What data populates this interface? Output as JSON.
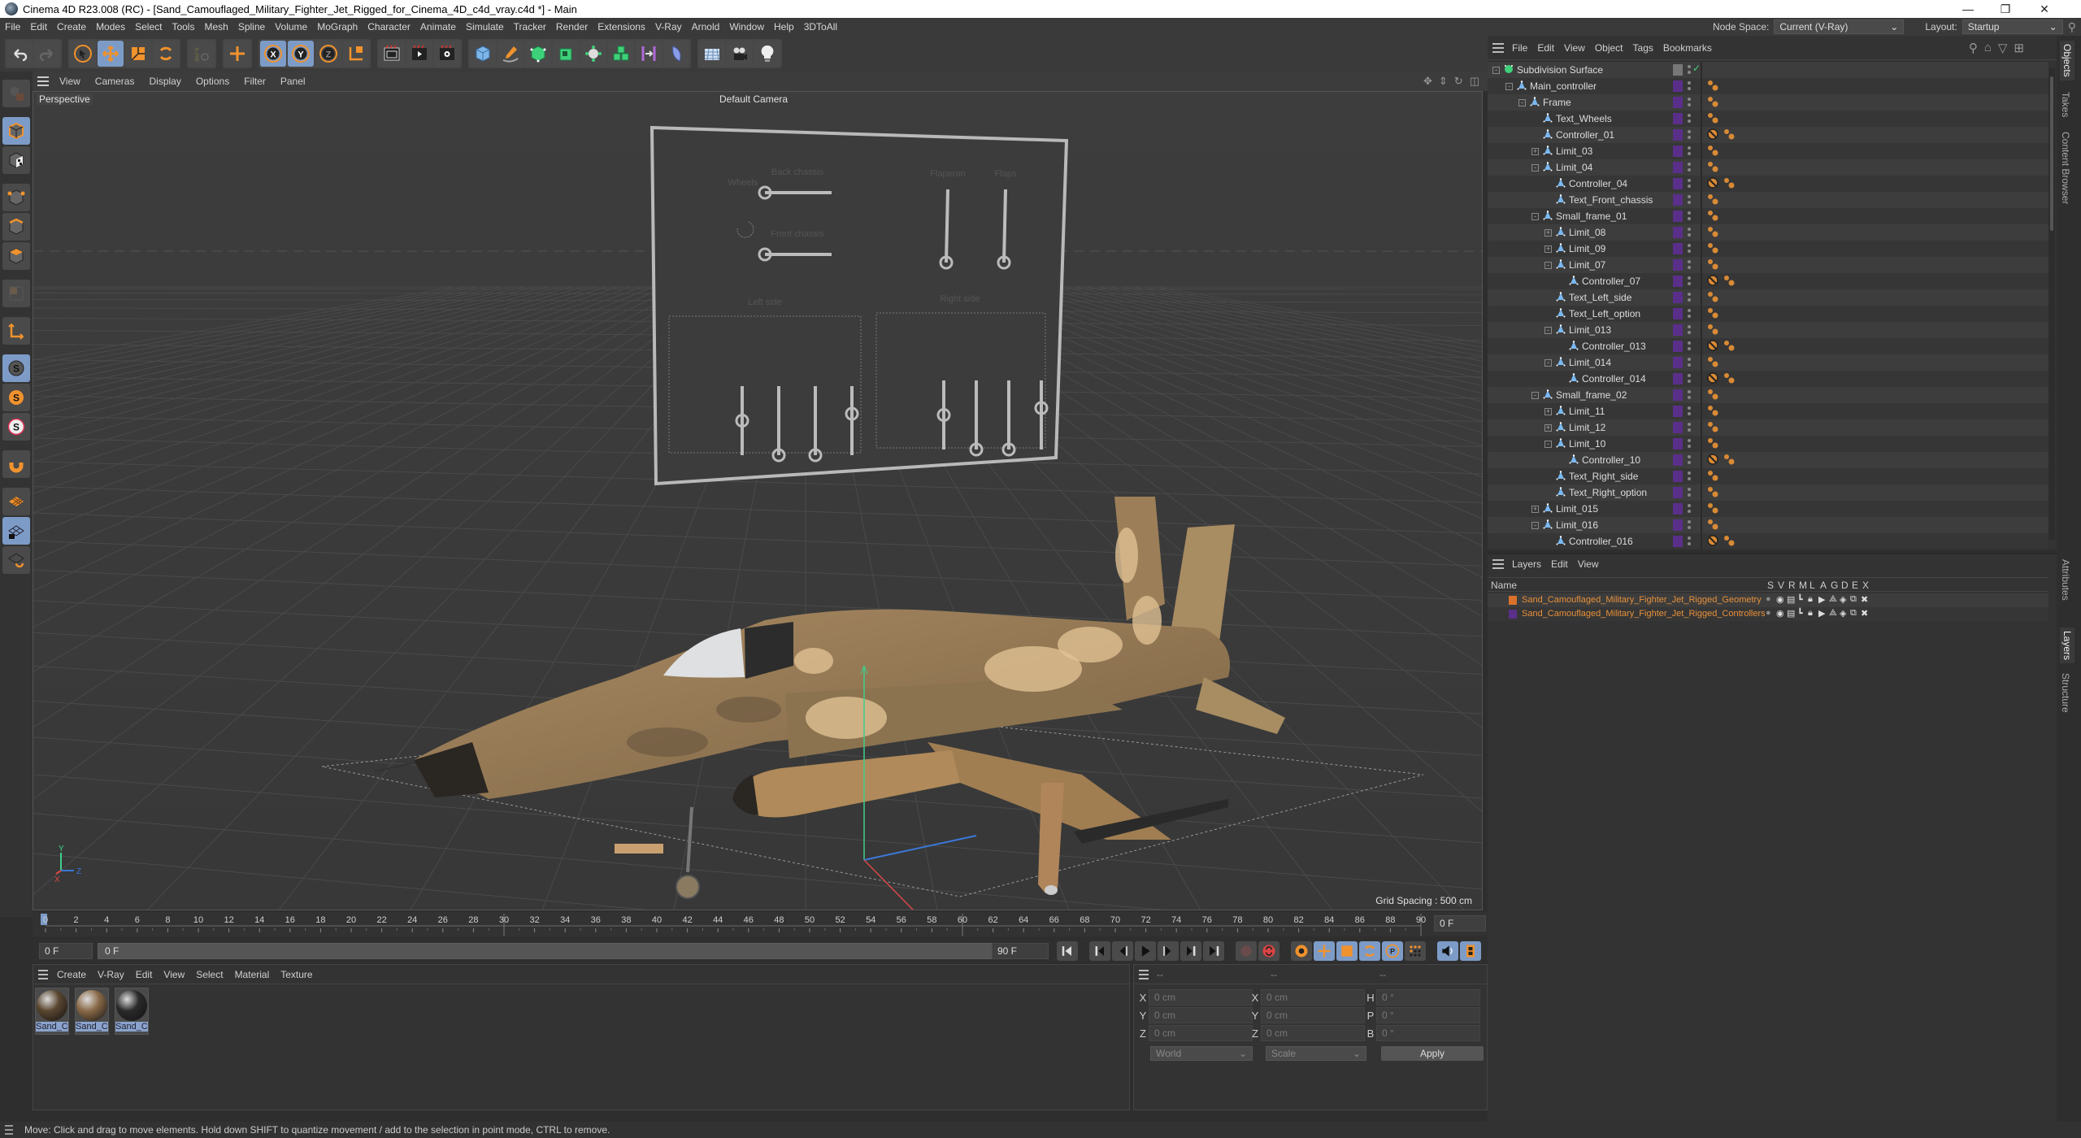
{
  "window": {
    "title": "Cinema 4D R23.008 (RC) - [Sand_Camouflaged_Military_Fighter_Jet_Rigged_for_Cinema_4D_c4d_vray.c4d *] - Main",
    "controls": {
      "minimize": "—",
      "maximize": "❐",
      "close": "✕"
    }
  },
  "menubar": {
    "items": [
      "File",
      "Edit",
      "Create",
      "Modes",
      "Select",
      "Tools",
      "Mesh",
      "Spline",
      "Volume",
      "MoGraph",
      "Character",
      "Animate",
      "Simulate",
      "Tracker",
      "Render",
      "Extensions",
      "V-Ray",
      "Arnold",
      "Window",
      "Help",
      "3DToAll"
    ],
    "node_space_label": "Node Space:",
    "node_space_value": "Current (V-Ray)",
    "layout_label": "Layout:",
    "layout_value": "Startup"
  },
  "toolbar": {
    "tools": [
      "undo",
      "redo",
      "select",
      "move",
      "scale",
      "rotate",
      "psr",
      "transform",
      "x-axis",
      "y-axis",
      "z-axis",
      "coord-system",
      "render-region",
      "render-view",
      "render-settings",
      "cube",
      "pen",
      "subdivision",
      "extrude",
      "array",
      "cloner",
      "symmetry",
      "deformer",
      "floor",
      "camera",
      "light"
    ],
    "active": [
      "move",
      "x-axis",
      "y-axis"
    ]
  },
  "left_toolbar": {
    "tools": [
      "make-editable",
      "model-mode",
      "texture-mode",
      "point-mode",
      "edge-mode",
      "polygon-mode",
      "uv-mode",
      "axis-mode",
      "snap",
      "snap-settings",
      "snap-3d",
      "magnet",
      "workplane",
      "workplane-lock",
      "workplane-align"
    ]
  },
  "viewport": {
    "menu": [
      "View",
      "Cameras",
      "Display",
      "Options",
      "Filter",
      "Panel"
    ],
    "projection": "Perspective",
    "camera": "Default Camera",
    "grid_spacing": "Grid Spacing : 500 cm",
    "axis_labels": {
      "x": "X",
      "y": "Y",
      "z": "Z"
    },
    "controls_board": {
      "top_sliders": [
        {
          "label": "Back chassis",
          "orientation": "horizontal",
          "value": 0
        },
        {
          "label": "Front chassis",
          "orientation": "horizontal",
          "value": 0
        },
        {
          "label": "Flaperon",
          "orientation": "vertical",
          "value": 0
        },
        {
          "label": "Flaps",
          "orientation": "vertical",
          "value": 0
        }
      ],
      "wheels_label": "Wheels",
      "left_group": {
        "label": "Left side",
        "sliders": [
          0.5,
          0,
          0,
          0.6
        ]
      },
      "right_group": {
        "label": "Right side",
        "sliders": [
          0.5,
          0,
          0,
          0.6
        ]
      }
    }
  },
  "timeline": {
    "ticks": [
      0,
      2,
      4,
      6,
      8,
      10,
      12,
      14,
      16,
      18,
      20,
      22,
      24,
      26,
      28,
      30,
      32,
      34,
      36,
      38,
      40,
      42,
      44,
      46,
      48,
      50,
      52,
      54,
      56,
      58,
      60,
      62,
      64,
      66,
      68,
      70,
      72,
      74,
      76,
      78,
      80,
      82,
      84,
      86,
      88,
      90
    ],
    "current_frame": "0 F",
    "start_field": "0 F",
    "range_start": "0 F",
    "range_end": "90 F",
    "end_field": "90 F",
    "current_frame_right": "0 F"
  },
  "material_manager": {
    "menu": [
      "Create",
      "V-Ray",
      "Edit",
      "View",
      "Select",
      "Material",
      "Texture"
    ],
    "materials": [
      {
        "name": "Sand_Ca",
        "color": "#5a4630"
      },
      {
        "name": "Sand_Ca",
        "color": "#8a6a48"
      },
      {
        "name": "Sand_Ca",
        "color": "#2a2a2a"
      }
    ]
  },
  "coordinates": {
    "header": [
      "--",
      "--",
      "--"
    ],
    "position": {
      "X": "0 cm",
      "Y": "0 cm",
      "Z": "0 cm"
    },
    "size": {
      "X": "0 cm",
      "Y": "0 cm",
      "Z": "0 cm"
    },
    "rotation": {
      "H": "0 °",
      "P": "0 °",
      "B": "0 °"
    },
    "mode": "World",
    "size_mode": "Scale",
    "apply": "Apply"
  },
  "status": "Move: Click and drag to move elements. Hold down SHIFT to quantize movement / add to the selection in point mode, CTRL to remove.",
  "object_manager": {
    "menu": [
      "File",
      "Edit",
      "View",
      "Object",
      "Tags",
      "Bookmarks"
    ],
    "objects": [
      {
        "name": "Subdivision Surface",
        "depth": 0,
        "exp": "-",
        "type": "subdiv",
        "tags": []
      },
      {
        "name": "Main_controller",
        "depth": 1,
        "exp": "-",
        "type": "null",
        "tags": [
          "xpresso"
        ]
      },
      {
        "name": "Frame",
        "depth": 2,
        "exp": "-",
        "type": "null",
        "tags": [
          "xpresso"
        ]
      },
      {
        "name": "Text_Wheels",
        "depth": 3,
        "exp": "",
        "type": "null",
        "tags": [
          "xpresso"
        ]
      },
      {
        "name": "Controller_01",
        "depth": 3,
        "exp": "",
        "type": "null",
        "tags": [
          "protect",
          "xpresso"
        ]
      },
      {
        "name": "Limit_03",
        "depth": 3,
        "exp": "+",
        "type": "null",
        "tags": [
          "xpresso"
        ]
      },
      {
        "name": "Limit_04",
        "depth": 3,
        "exp": "-",
        "type": "null",
        "tags": [
          "xpresso"
        ]
      },
      {
        "name": "Controller_04",
        "depth": 4,
        "exp": "",
        "type": "null",
        "tags": [
          "protect",
          "xpresso"
        ]
      },
      {
        "name": "Text_Front_chassis",
        "depth": 4,
        "exp": "",
        "type": "null",
        "tags": [
          "xpresso"
        ]
      },
      {
        "name": "Small_frame_01",
        "depth": 3,
        "exp": "-",
        "type": "null",
        "tags": [
          "xpresso"
        ]
      },
      {
        "name": "Limit_08",
        "depth": 4,
        "exp": "+",
        "type": "null",
        "tags": [
          "xpresso"
        ]
      },
      {
        "name": "Limit_09",
        "depth": 4,
        "exp": "+",
        "type": "null",
        "tags": [
          "xpresso"
        ]
      },
      {
        "name": "Limit_07",
        "depth": 4,
        "exp": "-",
        "type": "null",
        "tags": [
          "xpresso"
        ]
      },
      {
        "name": "Controller_07",
        "depth": 5,
        "exp": "",
        "type": "null",
        "tags": [
          "protect",
          "xpresso"
        ]
      },
      {
        "name": "Text_Left_side",
        "depth": 4,
        "exp": "",
        "type": "null",
        "tags": [
          "xpresso"
        ]
      },
      {
        "name": "Text_Left_option",
        "depth": 4,
        "exp": "",
        "type": "null",
        "tags": [
          "xpresso"
        ]
      },
      {
        "name": "Limit_013",
        "depth": 4,
        "exp": "-",
        "type": "null",
        "tags": [
          "xpresso"
        ]
      },
      {
        "name": "Controller_013",
        "depth": 5,
        "exp": "",
        "type": "null",
        "tags": [
          "protect",
          "xpresso"
        ]
      },
      {
        "name": "Limit_014",
        "depth": 4,
        "exp": "-",
        "type": "null",
        "tags": [
          "xpresso"
        ]
      },
      {
        "name": "Controller_014",
        "depth": 5,
        "exp": "",
        "type": "null",
        "tags": [
          "protect",
          "xpresso"
        ]
      },
      {
        "name": "Small_frame_02",
        "depth": 3,
        "exp": "-",
        "type": "null",
        "tags": [
          "xpresso"
        ]
      },
      {
        "name": "Limit_11",
        "depth": 4,
        "exp": "+",
        "type": "null",
        "tags": [
          "xpresso"
        ]
      },
      {
        "name": "Limit_12",
        "depth": 4,
        "exp": "+",
        "type": "null",
        "tags": [
          "xpresso"
        ]
      },
      {
        "name": "Limit_10",
        "depth": 4,
        "exp": "-",
        "type": "null",
        "tags": [
          "xpresso"
        ]
      },
      {
        "name": "Controller_10",
        "depth": 5,
        "exp": "",
        "type": "null",
        "tags": [
          "protect",
          "xpresso"
        ]
      },
      {
        "name": "Text_Right_side",
        "depth": 4,
        "exp": "",
        "type": "null",
        "tags": [
          "xpresso"
        ]
      },
      {
        "name": "Text_Right_option",
        "depth": 4,
        "exp": "",
        "type": "null",
        "tags": [
          "xpresso"
        ]
      },
      {
        "name": "Limit_015",
        "depth": 3,
        "exp": "+",
        "type": "null",
        "tags": [
          "xpresso"
        ]
      },
      {
        "name": "Limit_016",
        "depth": 3,
        "exp": "-",
        "type": "null",
        "tags": [
          "xpresso"
        ]
      },
      {
        "name": "Controller_016",
        "depth": 4,
        "exp": "",
        "type": "null",
        "tags": [
          "protect",
          "xpresso"
        ]
      }
    ]
  },
  "layer_manager": {
    "menu": [
      "Layers",
      "Edit",
      "View"
    ],
    "columns": [
      "Name",
      "S",
      "V",
      "R",
      "M",
      "L",
      "A",
      "G",
      "D",
      "E",
      "X"
    ],
    "layers": [
      {
        "name": "Sand_Camouflaged_Military_Fighter_Jet_Rigged_Geometry",
        "color": "#d9712a"
      },
      {
        "name": "Sand_Camouflaged_Military_Fighter_Jet_Rigged_Controllers",
        "color": "#5a2f8a"
      }
    ]
  },
  "side_tabs": {
    "top": [
      "Objects",
      "Takes",
      "Content Browser"
    ],
    "bottom": [
      "Attributes",
      "Layers",
      "Structure"
    ]
  }
}
